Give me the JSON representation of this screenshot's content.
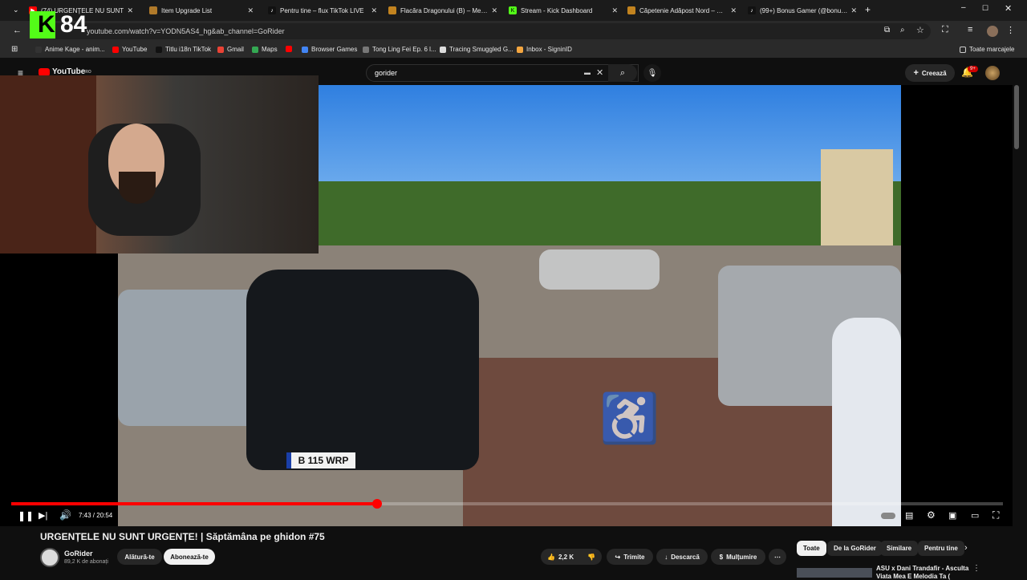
{
  "tabs": [
    {
      "label": "(74) URGENȚELE NU SUNT",
      "icon": "youtube-icon",
      "color": "#ff0000"
    },
    {
      "label": "Item Upgrade List",
      "icon": "metin-icon",
      "color": "#b07a2a"
    },
    {
      "label": "Pentru tine – flux TikTok LIVE",
      "icon": "tiktok-icon",
      "color": "#111111"
    },
    {
      "label": "Flacăra Dragonului (B) – Metin2",
      "icon": "metin-icon",
      "color": "#c2831f"
    },
    {
      "label": "Stream - Kick Dashboard",
      "icon": "kick-icon",
      "color": "#53fc18"
    },
    {
      "label": "Căpetenie Adăpost Nord – Metin2",
      "icon": "metin-icon",
      "color": "#c2831f"
    },
    {
      "label": "(99+) Bonus Gamer (@bonusga",
      "icon": "tiktok-icon",
      "color": "#111111"
    }
  ],
  "address": {
    "url": "youtube.com/watch?v=YODN5AS4_hg&ab_channel=GoRider"
  },
  "bookmarks": [
    {
      "label": "Anime Kage - anim..."
    },
    {
      "label": "YouTube"
    },
    {
      "label": "Titlu i18n TikTok"
    },
    {
      "label": "Gmail"
    },
    {
      "label": "Maps"
    },
    {
      "label": "Browser Games"
    },
    {
      "label": "Tong Ling Fei Ep. 6 l..."
    },
    {
      "label": "Tracing Smuggled G..."
    },
    {
      "label": "Inbox - SigninID"
    }
  ],
  "all_bookmarks": "Toate marcajele",
  "overlay": {
    "count": "84"
  },
  "youtube": {
    "logo": "YouTube",
    "region": "RO",
    "search_value": "gorider",
    "create": "Creează",
    "notif_badge": "9+"
  },
  "player": {
    "time": "7:43 / 20:54",
    "progress_fraction": 0.369,
    "plate": "B 115 WRP"
  },
  "video": {
    "title": "URGENȚELE NU SUNT URGENȚE! | Săptămâna pe ghidon #75",
    "channel": "GoRider",
    "subscribers": "89,2 K de abonați",
    "join": "Alătură-te",
    "subscribe": "Abonează-te",
    "likes": "2,2 K",
    "share": "Trimite",
    "download": "Descarcă",
    "thanks": "Mulțumire"
  },
  "chips": [
    "Toate",
    "De la GoRider",
    "Similare",
    "Pentru tine"
  ],
  "next_video": {
    "title_line1": "ASU x Dani Trandafir - Asculta",
    "title_line2": "Viata Mea E Melodia Ta ("
  }
}
